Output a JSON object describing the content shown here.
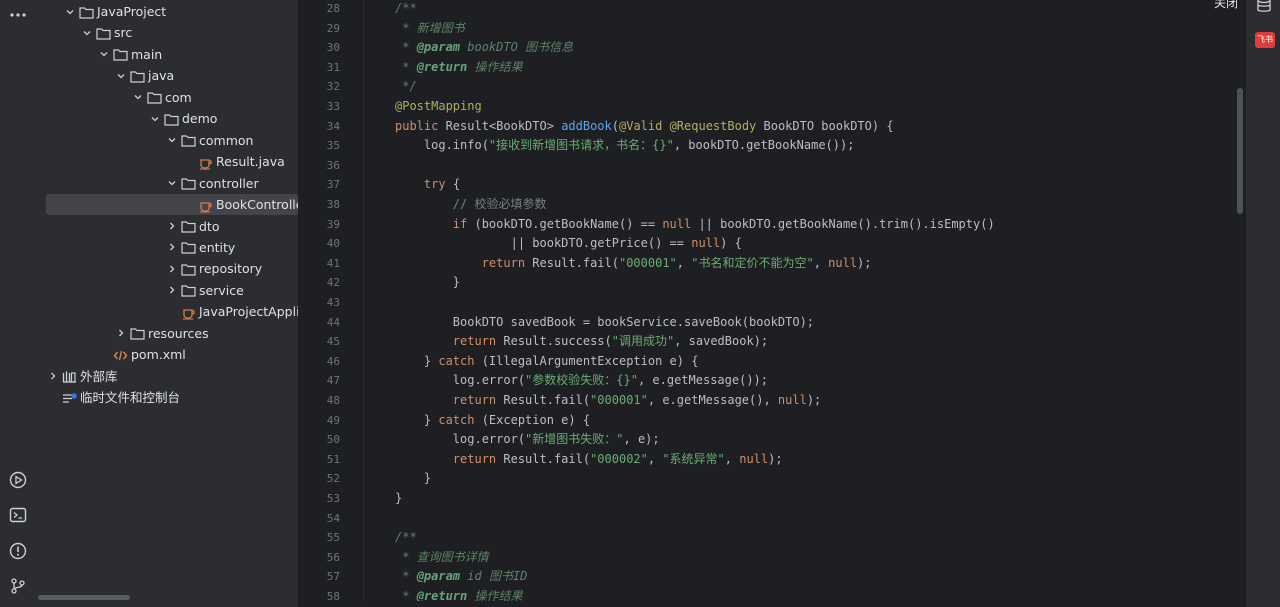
{
  "top_right": {
    "close_label": "关闭"
  },
  "badge": {
    "label": "飞书",
    "color": "#e03c3c"
  },
  "colors": {
    "background": "#1e1f22",
    "panel": "#2b2d30",
    "selection": "#43454a",
    "keyword": "#cf8e6d",
    "string": "#6aab73",
    "doc_comment": "#5f826b"
  },
  "activity_bar": {
    "icons": [
      {
        "name": "more-icon",
        "glyph": "⋯"
      },
      {
        "name": "run-icon",
        "glyph": "▷"
      },
      {
        "name": "terminal-icon",
        "glyph": ">_"
      },
      {
        "name": "problems-icon",
        "glyph": "!"
      },
      {
        "name": "git-icon",
        "glyph": "⑂"
      }
    ]
  },
  "tree": [
    {
      "label": "JavaProject",
      "depth": 1,
      "chevron": "down",
      "icon": "folder"
    },
    {
      "label": "src",
      "depth": 2,
      "chevron": "down",
      "icon": "folder"
    },
    {
      "label": "main",
      "depth": 3,
      "chevron": "down",
      "icon": "folder"
    },
    {
      "label": "java",
      "depth": 4,
      "chevron": "down",
      "icon": "folder"
    },
    {
      "label": "com",
      "depth": 5,
      "chevron": "down",
      "icon": "folder"
    },
    {
      "label": "demo",
      "depth": 6,
      "chevron": "down",
      "icon": "folder"
    },
    {
      "label": "common",
      "depth": 7,
      "chevron": "down",
      "icon": "folder"
    },
    {
      "label": "Result.java",
      "depth": 8,
      "chevron": "none",
      "icon": "java"
    },
    {
      "label": "controller",
      "depth": 7,
      "chevron": "down",
      "icon": "folder"
    },
    {
      "label": "BookController.",
      "depth": 8,
      "chevron": "none",
      "icon": "java",
      "selected": true
    },
    {
      "label": "dto",
      "depth": 7,
      "chevron": "right",
      "icon": "folder"
    },
    {
      "label": "entity",
      "depth": 7,
      "chevron": "right",
      "icon": "folder"
    },
    {
      "label": "repository",
      "depth": 7,
      "chevron": "right",
      "icon": "folder"
    },
    {
      "label": "service",
      "depth": 7,
      "chevron": "right",
      "icon": "folder"
    },
    {
      "label": "JavaProjectApplica",
      "depth": 7,
      "chevron": "none",
      "icon": "java"
    },
    {
      "label": "resources",
      "depth": 4,
      "chevron": "right",
      "icon": "folder"
    },
    {
      "label": "pom.xml",
      "depth": 3,
      "chevron": "none",
      "icon": "xml"
    },
    {
      "label": "外部库",
      "depth": 0,
      "chevron": "right",
      "icon": "library"
    },
    {
      "label": "临时文件和控制台",
      "depth": 0,
      "chevron": "none",
      "icon": "scratch"
    }
  ],
  "editor": {
    "lines": [
      {
        "n": "28",
        "tokens": [
          {
            "t": "doc",
            "v": "/**"
          }
        ]
      },
      {
        "n": "29",
        "tokens": [
          {
            "t": "doc",
            "v": " * 新增图书"
          }
        ]
      },
      {
        "n": "30",
        "tokens": [
          {
            "t": "doc",
            "v": " * "
          },
          {
            "t": "tag",
            "v": "@param"
          },
          {
            "t": "doc",
            "v": " bookDTO 图书信息"
          }
        ]
      },
      {
        "n": "31",
        "tokens": [
          {
            "t": "doc",
            "v": " * "
          },
          {
            "t": "tag",
            "v": "@return"
          },
          {
            "t": "doc",
            "v": " 操作结果"
          }
        ]
      },
      {
        "n": "32",
        "tokens": [
          {
            "t": "doc",
            "v": " */"
          }
        ]
      },
      {
        "n": "33",
        "tokens": [
          {
            "t": "ann",
            "v": "@PostMapping"
          }
        ]
      },
      {
        "n": "34",
        "tokens": [
          {
            "t": "kw",
            "v": "public"
          },
          {
            "t": "pl",
            "v": " Result<BookDTO> "
          },
          {
            "t": "fn",
            "v": "addBook"
          },
          {
            "t": "pl",
            "v": "("
          },
          {
            "t": "ann",
            "v": "@Valid @RequestBody"
          },
          {
            "t": "pl",
            "v": " BookDTO bookDTO) {"
          }
        ]
      },
      {
        "n": "35",
        "tokens": [
          {
            "t": "pl",
            "v": "    log.info("
          },
          {
            "t": "str",
            "v": "\"接收到新增图书请求，书名：{}\""
          },
          {
            "t": "pl",
            "v": ", bookDTO.getBookName());"
          }
        ]
      },
      {
        "n": "36",
        "tokens": []
      },
      {
        "n": "37",
        "tokens": [
          {
            "t": "pl",
            "v": "    "
          },
          {
            "t": "kw",
            "v": "try"
          },
          {
            "t": "pl",
            "v": " {"
          }
        ]
      },
      {
        "n": "38",
        "tokens": [
          {
            "t": "cmt",
            "v": "        // 校验必填参数"
          }
        ]
      },
      {
        "n": "39",
        "tokens": [
          {
            "t": "pl",
            "v": "        "
          },
          {
            "t": "kw",
            "v": "if"
          },
          {
            "t": "pl",
            "v": " (bookDTO.getBookName() == "
          },
          {
            "t": "kw",
            "v": "null"
          },
          {
            "t": "pl",
            "v": " || bookDTO.getBookName().trim().isEmpty()"
          }
        ]
      },
      {
        "n": "40",
        "tokens": [
          {
            "t": "pl",
            "v": "                || bookDTO.getPrice() == "
          },
          {
            "t": "kw",
            "v": "null"
          },
          {
            "t": "pl",
            "v": ") {"
          }
        ]
      },
      {
        "n": "41",
        "tokens": [
          {
            "t": "pl",
            "v": "            "
          },
          {
            "t": "kw",
            "v": "return"
          },
          {
            "t": "pl",
            "v": " Result.fail("
          },
          {
            "t": "str",
            "v": "\"000001\""
          },
          {
            "t": "pl",
            "v": ", "
          },
          {
            "t": "str",
            "v": "\"书名和定价不能为空\""
          },
          {
            "t": "pl",
            "v": ", "
          },
          {
            "t": "kw",
            "v": "null"
          },
          {
            "t": "pl",
            "v": ");"
          }
        ]
      },
      {
        "n": "42",
        "tokens": [
          {
            "t": "pl",
            "v": "        }"
          }
        ]
      },
      {
        "n": "43",
        "tokens": []
      },
      {
        "n": "44",
        "tokens": [
          {
            "t": "pl",
            "v": "        BookDTO savedBook = bookService.saveBook(bookDTO);"
          }
        ]
      },
      {
        "n": "45",
        "tokens": [
          {
            "t": "pl",
            "v": "        "
          },
          {
            "t": "kw",
            "v": "return"
          },
          {
            "t": "pl",
            "v": " Result.success("
          },
          {
            "t": "str",
            "v": "\"调用成功\""
          },
          {
            "t": "pl",
            "v": ", savedBook);"
          }
        ]
      },
      {
        "n": "46",
        "tokens": [
          {
            "t": "pl",
            "v": "    } "
          },
          {
            "t": "kw",
            "v": "catch"
          },
          {
            "t": "pl",
            "v": " (IllegalArgumentException e) {"
          }
        ]
      },
      {
        "n": "47",
        "tokens": [
          {
            "t": "pl",
            "v": "        log.error("
          },
          {
            "t": "str",
            "v": "\"参数校验失败：{}\""
          },
          {
            "t": "pl",
            "v": ", e.getMessage());"
          }
        ]
      },
      {
        "n": "48",
        "tokens": [
          {
            "t": "pl",
            "v": "        "
          },
          {
            "t": "kw",
            "v": "return"
          },
          {
            "t": "pl",
            "v": " Result.fail("
          },
          {
            "t": "str",
            "v": "\"000001\""
          },
          {
            "t": "pl",
            "v": ", e.getMessage(), "
          },
          {
            "t": "kw",
            "v": "null"
          },
          {
            "t": "pl",
            "v": ");"
          }
        ]
      },
      {
        "n": "49",
        "tokens": [
          {
            "t": "pl",
            "v": "    } "
          },
          {
            "t": "kw",
            "v": "catch"
          },
          {
            "t": "pl",
            "v": " (Exception e) {"
          }
        ]
      },
      {
        "n": "50",
        "tokens": [
          {
            "t": "pl",
            "v": "        log.error("
          },
          {
            "t": "str",
            "v": "\"新增图书失败：\""
          },
          {
            "t": "pl",
            "v": ", e);"
          }
        ]
      },
      {
        "n": "51",
        "tokens": [
          {
            "t": "pl",
            "v": "        "
          },
          {
            "t": "kw",
            "v": "return"
          },
          {
            "t": "pl",
            "v": " Result.fail("
          },
          {
            "t": "str",
            "v": "\"000002\""
          },
          {
            "t": "pl",
            "v": ", "
          },
          {
            "t": "str",
            "v": "\"系统异常\""
          },
          {
            "t": "pl",
            "v": ", "
          },
          {
            "t": "kw",
            "v": "null"
          },
          {
            "t": "pl",
            "v": ");"
          }
        ]
      },
      {
        "n": "52",
        "tokens": [
          {
            "t": "pl",
            "v": "    }"
          }
        ]
      },
      {
        "n": "53",
        "tokens": [
          {
            "t": "pl",
            "v": "}"
          }
        ]
      },
      {
        "n": "54",
        "tokens": []
      },
      {
        "n": "55",
        "tokens": [
          {
            "t": "doc",
            "v": "/**"
          }
        ]
      },
      {
        "n": "56",
        "tokens": [
          {
            "t": "doc",
            "v": " * 查询图书详情"
          }
        ]
      },
      {
        "n": "57",
        "tokens": [
          {
            "t": "doc",
            "v": " * "
          },
          {
            "t": "tag",
            "v": "@param"
          },
          {
            "t": "doc",
            "v": " id 图书ID"
          }
        ]
      },
      {
        "n": "58",
        "tokens": [
          {
            "t": "doc",
            "v": " * "
          },
          {
            "t": "tag",
            "v": "@return"
          },
          {
            "t": "doc",
            "v": " 操作结果"
          }
        ]
      },
      {
        "n": "59",
        "tokens": [
          {
            "t": "doc",
            "v": " */"
          }
        ]
      }
    ]
  }
}
